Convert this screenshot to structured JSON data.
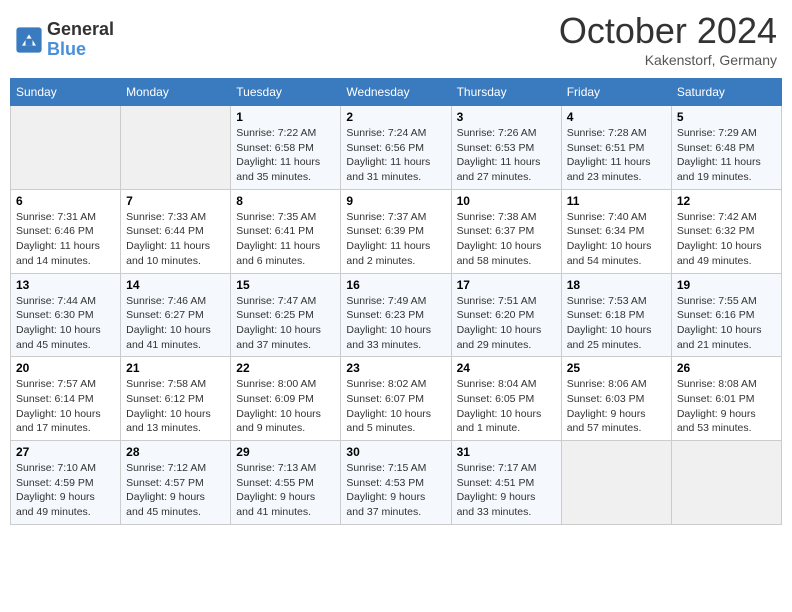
{
  "header": {
    "logo_general": "General",
    "logo_blue": "Blue",
    "month": "October 2024",
    "location": "Kakenstorf, Germany"
  },
  "days_of_week": [
    "Sunday",
    "Monday",
    "Tuesday",
    "Wednesday",
    "Thursday",
    "Friday",
    "Saturday"
  ],
  "weeks": [
    [
      {
        "day": "",
        "content": ""
      },
      {
        "day": "",
        "content": ""
      },
      {
        "day": "1",
        "content": "Sunrise: 7:22 AM\nSunset: 6:58 PM\nDaylight: 11 hours and 35 minutes."
      },
      {
        "day": "2",
        "content": "Sunrise: 7:24 AM\nSunset: 6:56 PM\nDaylight: 11 hours and 31 minutes."
      },
      {
        "day": "3",
        "content": "Sunrise: 7:26 AM\nSunset: 6:53 PM\nDaylight: 11 hours and 27 minutes."
      },
      {
        "day": "4",
        "content": "Sunrise: 7:28 AM\nSunset: 6:51 PM\nDaylight: 11 hours and 23 minutes."
      },
      {
        "day": "5",
        "content": "Sunrise: 7:29 AM\nSunset: 6:48 PM\nDaylight: 11 hours and 19 minutes."
      }
    ],
    [
      {
        "day": "6",
        "content": "Sunrise: 7:31 AM\nSunset: 6:46 PM\nDaylight: 11 hours and 14 minutes."
      },
      {
        "day": "7",
        "content": "Sunrise: 7:33 AM\nSunset: 6:44 PM\nDaylight: 11 hours and 10 minutes."
      },
      {
        "day": "8",
        "content": "Sunrise: 7:35 AM\nSunset: 6:41 PM\nDaylight: 11 hours and 6 minutes."
      },
      {
        "day": "9",
        "content": "Sunrise: 7:37 AM\nSunset: 6:39 PM\nDaylight: 11 hours and 2 minutes."
      },
      {
        "day": "10",
        "content": "Sunrise: 7:38 AM\nSunset: 6:37 PM\nDaylight: 10 hours and 58 minutes."
      },
      {
        "day": "11",
        "content": "Sunrise: 7:40 AM\nSunset: 6:34 PM\nDaylight: 10 hours and 54 minutes."
      },
      {
        "day": "12",
        "content": "Sunrise: 7:42 AM\nSunset: 6:32 PM\nDaylight: 10 hours and 49 minutes."
      }
    ],
    [
      {
        "day": "13",
        "content": "Sunrise: 7:44 AM\nSunset: 6:30 PM\nDaylight: 10 hours and 45 minutes."
      },
      {
        "day": "14",
        "content": "Sunrise: 7:46 AM\nSunset: 6:27 PM\nDaylight: 10 hours and 41 minutes."
      },
      {
        "day": "15",
        "content": "Sunrise: 7:47 AM\nSunset: 6:25 PM\nDaylight: 10 hours and 37 minutes."
      },
      {
        "day": "16",
        "content": "Sunrise: 7:49 AM\nSunset: 6:23 PM\nDaylight: 10 hours and 33 minutes."
      },
      {
        "day": "17",
        "content": "Sunrise: 7:51 AM\nSunset: 6:20 PM\nDaylight: 10 hours and 29 minutes."
      },
      {
        "day": "18",
        "content": "Sunrise: 7:53 AM\nSunset: 6:18 PM\nDaylight: 10 hours and 25 minutes."
      },
      {
        "day": "19",
        "content": "Sunrise: 7:55 AM\nSunset: 6:16 PM\nDaylight: 10 hours and 21 minutes."
      }
    ],
    [
      {
        "day": "20",
        "content": "Sunrise: 7:57 AM\nSunset: 6:14 PM\nDaylight: 10 hours and 17 minutes."
      },
      {
        "day": "21",
        "content": "Sunrise: 7:58 AM\nSunset: 6:12 PM\nDaylight: 10 hours and 13 minutes."
      },
      {
        "day": "22",
        "content": "Sunrise: 8:00 AM\nSunset: 6:09 PM\nDaylight: 10 hours and 9 minutes."
      },
      {
        "day": "23",
        "content": "Sunrise: 8:02 AM\nSunset: 6:07 PM\nDaylight: 10 hours and 5 minutes."
      },
      {
        "day": "24",
        "content": "Sunrise: 8:04 AM\nSunset: 6:05 PM\nDaylight: 10 hours and 1 minute."
      },
      {
        "day": "25",
        "content": "Sunrise: 8:06 AM\nSunset: 6:03 PM\nDaylight: 9 hours and 57 minutes."
      },
      {
        "day": "26",
        "content": "Sunrise: 8:08 AM\nSunset: 6:01 PM\nDaylight: 9 hours and 53 minutes."
      }
    ],
    [
      {
        "day": "27",
        "content": "Sunrise: 7:10 AM\nSunset: 4:59 PM\nDaylight: 9 hours and 49 minutes."
      },
      {
        "day": "28",
        "content": "Sunrise: 7:12 AM\nSunset: 4:57 PM\nDaylight: 9 hours and 45 minutes."
      },
      {
        "day": "29",
        "content": "Sunrise: 7:13 AM\nSunset: 4:55 PM\nDaylight: 9 hours and 41 minutes."
      },
      {
        "day": "30",
        "content": "Sunrise: 7:15 AM\nSunset: 4:53 PM\nDaylight: 9 hours and 37 minutes."
      },
      {
        "day": "31",
        "content": "Sunrise: 7:17 AM\nSunset: 4:51 PM\nDaylight: 9 hours and 33 minutes."
      },
      {
        "day": "",
        "content": ""
      },
      {
        "day": "",
        "content": ""
      }
    ]
  ]
}
